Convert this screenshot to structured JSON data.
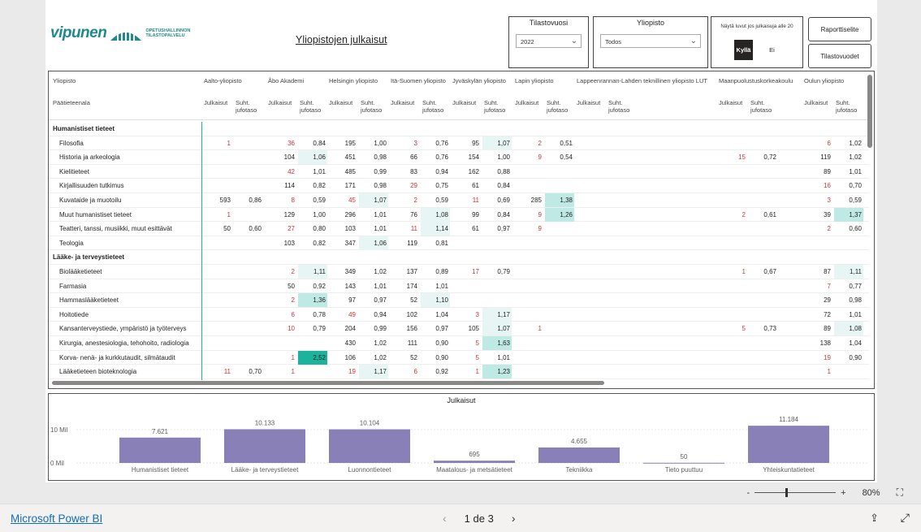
{
  "report": {
    "title": "Yliopistojen julkaisut",
    "logo": "vipunen",
    "logo_sub1": "OPETUSHALLINNON",
    "logo_sub2": "TILASTOPALVELU"
  },
  "slicers": {
    "year": {
      "title": "Tilastovuosi",
      "value": "2022"
    },
    "university": {
      "title": "Yliopisto",
      "value": "Todos"
    },
    "toggle": {
      "label": "Näytä luvut jos julkaisuja alle 20",
      "yes": "Kyllä",
      "no": "Ei"
    }
  },
  "buttons": {
    "report_desc": "Raporttiselite",
    "stat_years": "Tilastovuodet"
  },
  "matrix": {
    "row_header": "Yliopisto",
    "field_header": "Päätieteenala",
    "universities": [
      "Aalto-yliopisto",
      "Åbo Akademi",
      "Helsingin yliopisto",
      "Itä-Suomen yliopisto",
      "Jyväskylän yliopisto",
      "Lapin yliopisto",
      "Lappeenrannan-Lahden teknillinen yliopisto LUT",
      "Maanpuolustuskorkeakoulu",
      "Oulun yliopisto"
    ],
    "col_j": "Julkaisut",
    "col_s": "Suht. jufotaso",
    "rows": [
      {
        "label": "Humanistiset tieteet",
        "cat": true,
        "cells": []
      },
      {
        "label": "Filosofia",
        "cells": [
          [
            "1",
            "",
            1
          ],
          [
            "36",
            "0,84",
            1
          ],
          [
            "195",
            "1,00",
            0
          ],
          [
            "3",
            "0,76",
            1
          ],
          [
            "95",
            "1,07",
            0
          ],
          [
            "2",
            "0,51",
            1
          ],
          [
            "",
            ""
          ],
          [
            "",
            ""
          ],
          [
            "6",
            "1,02",
            1
          ]
        ]
      },
      {
        "label": "Historia ja arkeologia",
        "cells": [
          [
            "",
            ""
          ],
          [
            "104",
            "1,06",
            0
          ],
          [
            "451",
            "0,98",
            0
          ],
          [
            "66",
            "0,76",
            0
          ],
          [
            "154",
            "1,00",
            0
          ],
          [
            "9",
            "0,54",
            1
          ],
          [
            "",
            ""
          ],
          [
            "15",
            "0,72",
            1
          ],
          [
            "119",
            "1,02",
            0
          ]
        ]
      },
      {
        "label": "Kielitieteet",
        "cells": [
          [
            "",
            ""
          ],
          [
            "42",
            "1,01",
            1
          ],
          [
            "485",
            "0,99",
            0
          ],
          [
            "83",
            "0,94",
            0
          ],
          [
            "162",
            "0,88",
            0
          ],
          [
            "",
            ""
          ],
          [
            "",
            ""
          ],
          [
            "",
            ""
          ],
          [
            "89",
            "1,01",
            0
          ]
        ]
      },
      {
        "label": "Kirjallisuuden tutkimus",
        "cells": [
          [
            "",
            ""
          ],
          [
            "114",
            "0,82",
            0
          ],
          [
            "171",
            "0,98",
            0
          ],
          [
            "29",
            "0,75",
            1
          ],
          [
            "61",
            "0,84",
            0
          ],
          [
            "",
            ""
          ],
          [
            "",
            ""
          ],
          [
            "",
            ""
          ],
          [
            "16",
            "0,70",
            1
          ]
        ]
      },
      {
        "label": "Kuvataide ja muotoilu",
        "cells": [
          [
            "593",
            "0,86",
            0
          ],
          [
            "8",
            "0,59",
            1
          ],
          [
            "45",
            "1,07",
            1
          ],
          [
            "2",
            "0,59",
            1
          ],
          [
            "11",
            "0,69",
            1
          ],
          [
            "285",
            "1,38",
            0
          ],
          [
            "",
            ""
          ],
          [
            "",
            ""
          ],
          [
            "3",
            "0,59",
            1
          ]
        ]
      },
      {
        "label": "Muut humanistiset tieteet",
        "cells": [
          [
            "1",
            "",
            1
          ],
          [
            "129",
            "1,00",
            0
          ],
          [
            "296",
            "1,01",
            0
          ],
          [
            "76",
            "1,08",
            0
          ],
          [
            "99",
            "0,84",
            0
          ],
          [
            "9",
            "1,26",
            1
          ],
          [
            "",
            ""
          ],
          [
            "2",
            "0,61",
            1
          ],
          [
            "39",
            "1,37",
            0
          ]
        ]
      },
      {
        "label": "Teatteri, tanssi, musiikki, muut esittävät",
        "cells": [
          [
            "50",
            "0,60",
            0
          ],
          [
            "27",
            "0,80",
            1
          ],
          [
            "103",
            "1,01",
            0
          ],
          [
            "11",
            "1,14",
            1
          ],
          [
            "61",
            "0,97",
            0
          ],
          [
            "9",
            "",
            1
          ],
          [
            "",
            ""
          ],
          [
            "",
            ""
          ],
          [
            "2",
            "0,60",
            1
          ]
        ]
      },
      {
        "label": "Teologia",
        "cells": [
          [
            "",
            ""
          ],
          [
            "103",
            "0,82",
            0
          ],
          [
            "347",
            "1,06",
            0
          ],
          [
            "119",
            "0,81",
            0
          ],
          [
            "",
            ""
          ],
          [
            "",
            ""
          ],
          [
            "",
            ""
          ],
          [
            "",
            ""
          ],
          [
            "",
            ""
          ]
        ]
      },
      {
        "label": "Lääke- ja terveystieteet",
        "cat": true,
        "cells": []
      },
      {
        "label": "Biolääketieteet",
        "cells": [
          [
            "",
            ""
          ],
          [
            "2",
            "1,11",
            1
          ],
          [
            "349",
            "1,02",
            0
          ],
          [
            "137",
            "0,89",
            0
          ],
          [
            "17",
            "0,79",
            1
          ],
          [
            "",
            ""
          ],
          [
            "",
            ""
          ],
          [
            "1",
            "0,67",
            1
          ],
          [
            "87",
            "1,11",
            0
          ]
        ]
      },
      {
        "label": "Farmasia",
        "cells": [
          [
            "",
            ""
          ],
          [
            "50",
            "0,92",
            0
          ],
          [
            "143",
            "1,01",
            0
          ],
          [
            "174",
            "1,01",
            0
          ],
          [
            "",
            ""
          ],
          [
            "",
            ""
          ],
          [
            "",
            ""
          ],
          [
            "",
            ""
          ],
          [
            "7",
            "0,77",
            1
          ]
        ]
      },
      {
        "label": "Hammaslääketieteet",
        "cells": [
          [
            "",
            ""
          ],
          [
            "2",
            "1,36",
            1
          ],
          [
            "97",
            "0,97",
            0
          ],
          [
            "52",
            "1,10",
            0
          ],
          [
            "",
            ""
          ],
          [
            "",
            ""
          ],
          [
            "",
            ""
          ],
          [
            "",
            ""
          ],
          [
            "29",
            "0,98",
            0
          ]
        ]
      },
      {
        "label": "Hoitotiede",
        "cells": [
          [
            "",
            ""
          ],
          [
            "6",
            "0,78",
            1
          ],
          [
            "49",
            "0,94",
            1
          ],
          [
            "102",
            "1,04",
            0
          ],
          [
            "3",
            "1,17",
            1
          ],
          [
            "",
            ""
          ],
          [
            "",
            ""
          ],
          [
            "",
            ""
          ],
          [
            "72",
            "1,01",
            0
          ]
        ]
      },
      {
        "label": "Kansanterveystiede, ympäristö ja työterveys",
        "cells": [
          [
            "",
            ""
          ],
          [
            "10",
            "0,79",
            1
          ],
          [
            "204",
            "0,99",
            0
          ],
          [
            "156",
            "0,97",
            0
          ],
          [
            "105",
            "1,07",
            0
          ],
          [
            "1",
            "",
            1
          ],
          [
            "",
            ""
          ],
          [
            "5",
            "0,73",
            1
          ],
          [
            "89",
            "1,08",
            0
          ]
        ]
      },
      {
        "label": "Kirurgia, anestesiologia, tehohoito, radiologia",
        "cells": [
          [
            "",
            ""
          ],
          [
            "",
            ""
          ],
          [
            "430",
            "1,02",
            0
          ],
          [
            "111",
            "0,90",
            0
          ],
          [
            "5",
            "1,63",
            1
          ],
          [
            "",
            ""
          ],
          [
            "",
            ""
          ],
          [
            "",
            ""
          ],
          [
            "138",
            "1,04",
            0
          ]
        ]
      },
      {
        "label": "Korva- nenä- ja kurkkutaudit, silmätaudit",
        "cells": [
          [
            "",
            ""
          ],
          [
            "1",
            "2,52",
            1
          ],
          [
            "106",
            "1,02",
            0
          ],
          [
            "52",
            "0,90",
            0
          ],
          [
            "5",
            "1,01",
            1
          ],
          [
            "",
            ""
          ],
          [
            "",
            ""
          ],
          [
            "",
            ""
          ],
          [
            "19",
            "0,90",
            1
          ]
        ]
      },
      {
        "label": "Lääketieteen bioteknologia",
        "cells": [
          [
            "11",
            "0,70",
            1
          ],
          [
            "1",
            "",
            1
          ],
          [
            "19",
            "1,17",
            1
          ],
          [
            "6",
            "0,92",
            1
          ],
          [
            "1",
            "1,23",
            1
          ],
          [
            "",
            ""
          ],
          [
            "",
            ""
          ],
          [
            "",
            ""
          ],
          [
            "1",
            "",
            1
          ]
        ]
      }
    ]
  },
  "chart_data": {
    "type": "bar",
    "title": "Julkaisut",
    "categories": [
      "Humanistiset tieteet",
      "Lääke- ja terveystieteet",
      "Luonnontieteet",
      "Maatalous- ja metsätieteet",
      "Tekniikka",
      "Tieto puuttuu",
      "Yhteiskuntatieteet"
    ],
    "values": [
      7621,
      10133,
      10104,
      695,
      4655,
      50,
      11184
    ],
    "labels": [
      "7.621",
      "10.133",
      "10.104",
      "695",
      "4.655",
      "50",
      "11.184"
    ],
    "yticks": [
      "0 Mil",
      "10 Mil"
    ],
    "ylim": [
      0,
      12000
    ],
    "color": "#8a80b8"
  },
  "zoom": {
    "value": "80%",
    "minus": "-",
    "plus": "+"
  },
  "footer": {
    "brand": "Microsoft Power BI",
    "page": "1 de 3"
  }
}
